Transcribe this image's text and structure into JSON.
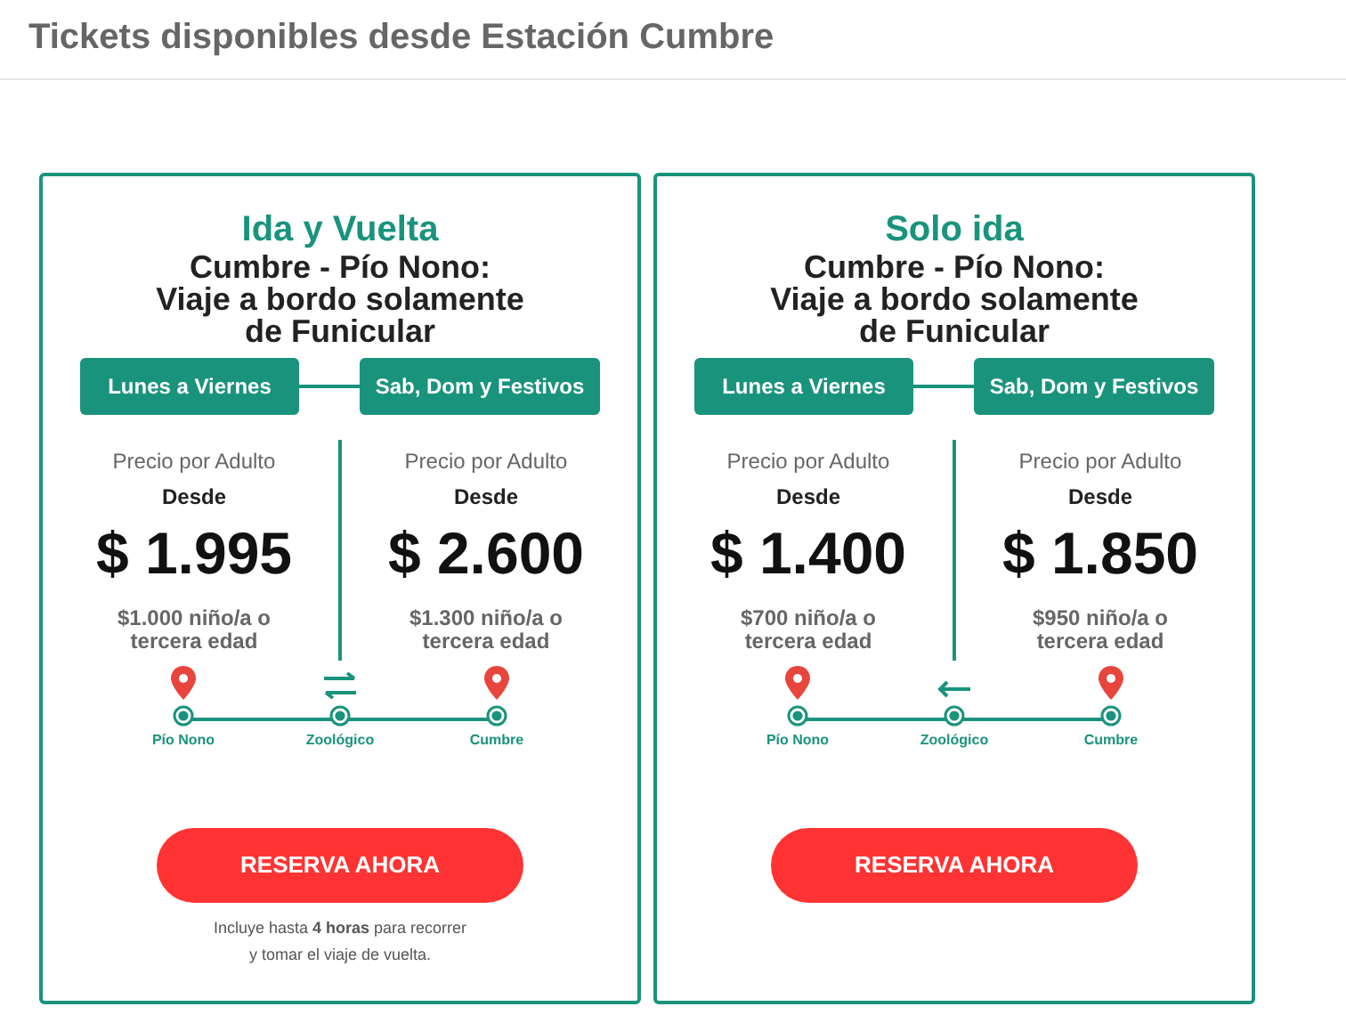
{
  "heading": "Tickets disponibles desde Estación Cumbre",
  "cards": [
    {
      "title": "Ida y Vuelta",
      "subtitle": "Cumbre - Pío Nono:\nViaje a bordo solamente\nde Funicular",
      "kind": "round_trip",
      "days": [
        "Lunes a Viernes",
        "Sab, Dom y Festivos"
      ],
      "prices": [
        {
          "label": "Precio por Adulto",
          "from": "Desde",
          "price": "$ 1.995",
          "reduced": "$1.000 niño/a o\ntercera edad"
        },
        {
          "label": "Precio por Adulto",
          "from": "Desde",
          "price": "$ 2.600",
          "reduced": "$1.300 niño/a o\ntercera edad"
        }
      ],
      "stations": [
        "Pío Nono",
        "Zoológico",
        "Cumbre"
      ],
      "button": "RESERVA AHORA",
      "note": "Incluye hasta **4 horas** para recorrer\ny tomar el viaje de vuelta."
    },
    {
      "title": "Solo ida",
      "subtitle": "Cumbre - Pío Nono:\nViaje a bordo solamente\nde Funicular",
      "kind": "one_way",
      "days": [
        "Lunes a Viernes",
        "Sab, Dom y Festivos"
      ],
      "prices": [
        {
          "label": "Precio por Adulto",
          "from": "Desde",
          "price": "$ 1.400",
          "reduced": "$700 niño/a o\ntercera edad"
        },
        {
          "label": "Precio por Adulto",
          "from": "Desde",
          "price": "$ 1.850",
          "reduced": "$950 niño/a o\ntercera edad"
        }
      ],
      "stations": [
        "Pío Nono",
        "Zoológico",
        "Cumbre"
      ],
      "button": "RESERVA AHORA"
    }
  ]
}
